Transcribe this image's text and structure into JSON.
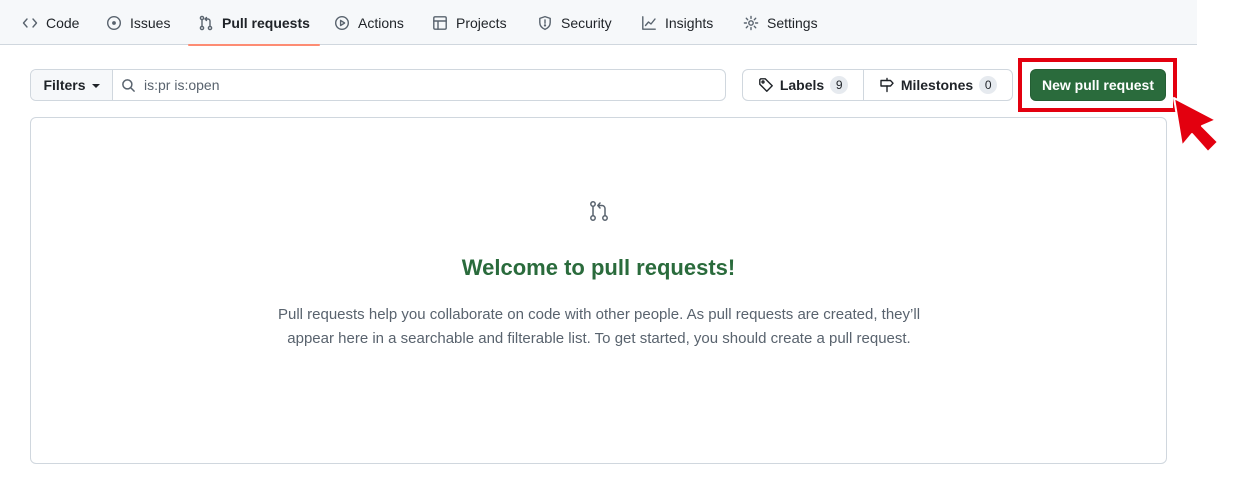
{
  "nav": {
    "items": [
      {
        "label": "Code",
        "icon": "code-icon"
      },
      {
        "label": "Issues",
        "icon": "issue-opened-icon"
      },
      {
        "label": "Pull requests",
        "icon": "git-pull-request-icon",
        "active": true
      },
      {
        "label": "Actions",
        "icon": "play-icon"
      },
      {
        "label": "Projects",
        "icon": "table-icon"
      },
      {
        "label": "Security",
        "icon": "shield-icon"
      },
      {
        "label": "Insights",
        "icon": "graph-icon"
      },
      {
        "label": "Settings",
        "icon": "gear-icon"
      }
    ],
    "active_underline_color": "#fd8c73"
  },
  "toolbar": {
    "filters_label": "Filters",
    "search_value": "is:pr is:open",
    "labels_label": "Labels",
    "labels_count": "9",
    "milestones_label": "Milestones",
    "milestones_count": "0",
    "new_pr_label": "New pull request"
  },
  "blankslate": {
    "title": "Welcome to pull requests!",
    "description": "Pull requests help you collaborate on code with other people. As pull requests are created, they’ll appear here in a searchable and filterable list. To get started, you should create a pull request."
  },
  "colors": {
    "primary_button": "#2a6b3c",
    "highlight_box": "#e3000f",
    "title_green": "#2a6b3c"
  }
}
